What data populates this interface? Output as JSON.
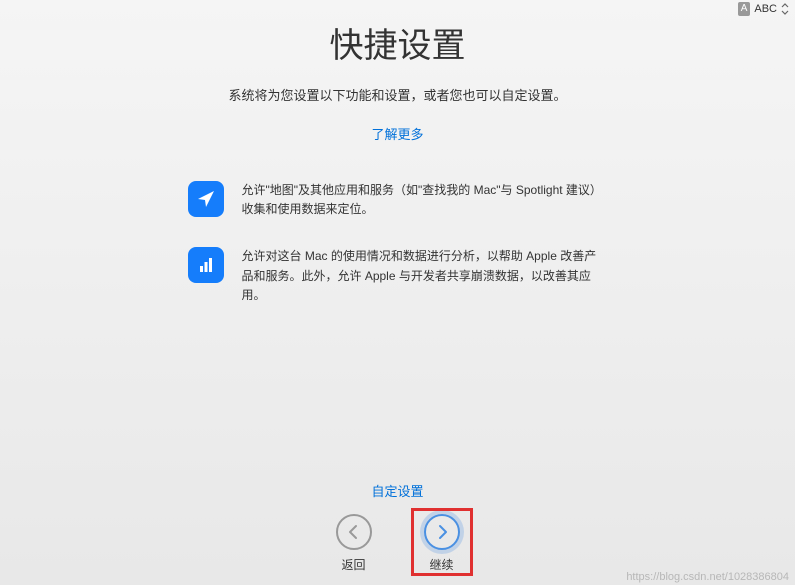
{
  "input_indicator": {
    "badge": "A",
    "mode": "ABC"
  },
  "title": "快捷设置",
  "subtitle": "系统将为您设置以下功能和设置，或者您也可以自定设置。",
  "learn_more": "了解更多",
  "features": [
    {
      "icon": "location",
      "text": "允许\"地图\"及其他应用和服务（如\"查找我的 Mac\"与 Spotlight 建议）收集和使用数据来定位。"
    },
    {
      "icon": "analytics",
      "text": "允许对这台 Mac 的使用情况和数据进行分析，以帮助 Apple 改善产品和服务。此外，允许 Apple 与开发者共享崩溃数据，以改善其应用。"
    }
  ],
  "customize": "自定设置",
  "nav": {
    "back": "返回",
    "continue": "继续"
  },
  "watermark": "https://blog.csdn.net/1028386804"
}
